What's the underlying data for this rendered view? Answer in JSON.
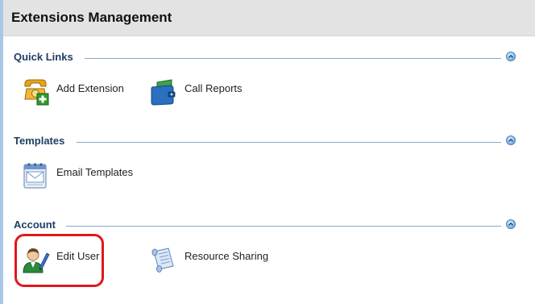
{
  "page": {
    "title": "Extensions Management"
  },
  "sections": {
    "quick_links": {
      "title": "Quick Links",
      "items": {
        "add_extension": {
          "label": "Add Extension",
          "icon": "phone-add-icon"
        },
        "call_reports": {
          "label": "Call Reports",
          "icon": "report-binder-icon"
        }
      }
    },
    "templates": {
      "title": "Templates",
      "items": {
        "email_templates": {
          "label": "Email Templates",
          "icon": "email-calendar-icon"
        }
      }
    },
    "account": {
      "title": "Account",
      "items": {
        "edit_user": {
          "label": "Edit User",
          "icon": "user-edit-icon"
        },
        "resource_sharing": {
          "label": "Resource Sharing",
          "icon": "scroll-document-icon"
        }
      }
    }
  },
  "annotation": {
    "highlight_color": "#e0171c"
  },
  "colors": {
    "section_title": "#1f3e63",
    "title_bar": "#e3e3e3",
    "left_accent": "#a9c8e8"
  }
}
